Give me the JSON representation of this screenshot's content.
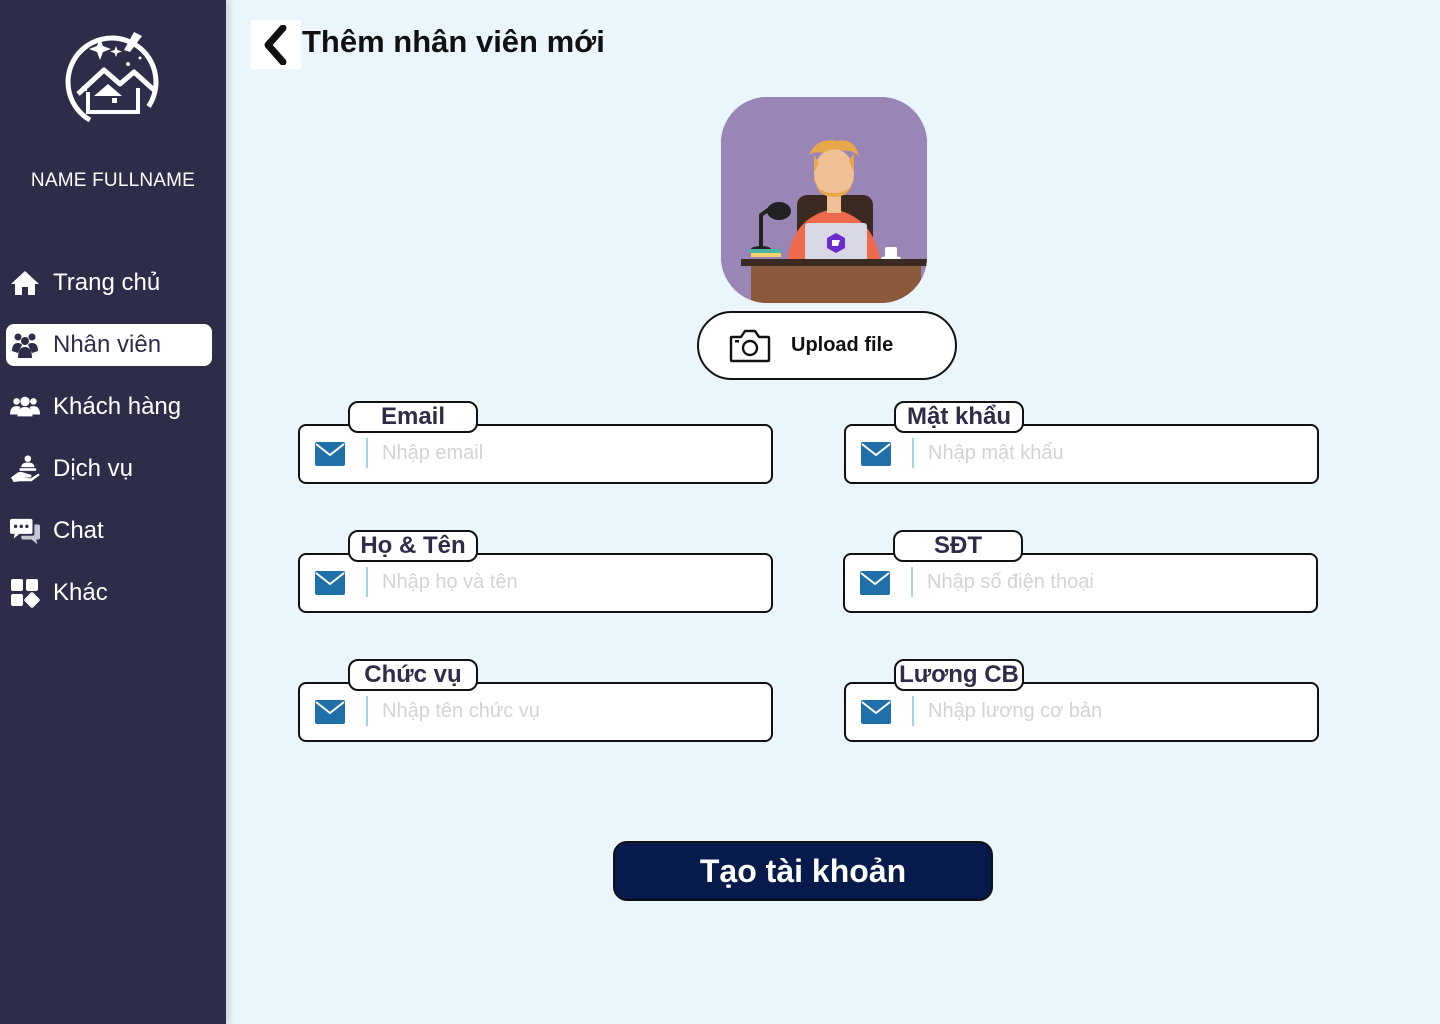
{
  "sidebar": {
    "user_name": "NAME FULLNAME",
    "items": [
      {
        "label": "Trang chủ",
        "icon": "home-icon"
      },
      {
        "label": "Nhân viên",
        "icon": "employees-icon",
        "active": true
      },
      {
        "label": "Khách hàng",
        "icon": "customers-icon"
      },
      {
        "label": "Dịch vụ",
        "icon": "service-icon"
      },
      {
        "label": "Chat",
        "icon": "chat-icon"
      },
      {
        "label": "Khác",
        "icon": "grid-icon"
      }
    ]
  },
  "header": {
    "title": "Thêm nhân viên mới",
    "back_icon": "chevron-left-icon"
  },
  "avatar": {
    "upload_label": "Upload file",
    "icon": "camera-icon"
  },
  "form": {
    "email": {
      "label": "Email",
      "placeholder": "Nhập email",
      "icon": "mail-icon"
    },
    "password": {
      "label": "Mật khẩu",
      "placeholder": "Nhập mật khẩu",
      "icon": "mail-icon"
    },
    "fullname": {
      "label": "Họ & Tên",
      "placeholder": "Nhập họ và tên",
      "icon": "mail-icon"
    },
    "phone": {
      "label": "SĐT",
      "placeholder": "Nhập số điện thoại",
      "icon": "mail-icon"
    },
    "position": {
      "label": "Chức vụ",
      "placeholder": "Nhập tên chức vụ",
      "icon": "mail-icon"
    },
    "salary": {
      "label": "Lương CB",
      "placeholder": "Nhập lương cơ bản",
      "icon": "mail-icon"
    }
  },
  "submit_label": "Tạo tài khoản",
  "colors": {
    "sidebar_bg": "#2d2d4a",
    "page_bg": "#eaf6fc",
    "mail_icon": "#1f6fa8",
    "submit_bg": "#061a4b"
  }
}
